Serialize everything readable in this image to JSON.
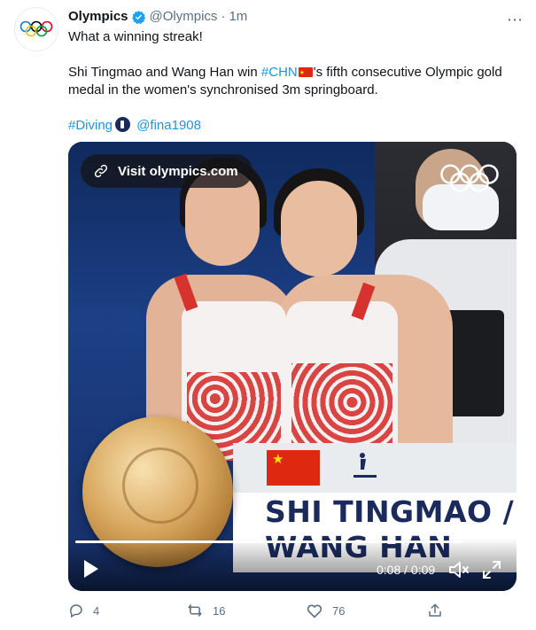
{
  "tweet": {
    "author_name": "Olympics",
    "handle": "@Olympics",
    "separator": "·",
    "time": "1m",
    "more_label": "⋯",
    "line1": "What a winning streak!",
    "line2_prefix": "Shi Tingmao and Wang Han win ",
    "hashtag_chn": "#CHN",
    "line2_suffix": "'s fifth consecutive Olympic gold medal in the women's synchronised 3m springboard.",
    "hashtag_diving": "#Diving",
    "mention": "@fina1908"
  },
  "media": {
    "visit_label": "Visit olympics.com",
    "banner_text_line1": "SHI TINGMAO /",
    "banner_text_line2": "WANG HAN",
    "time_readout": "0:08 / 0:09",
    "progress": 0.89
  },
  "actions": {
    "reply_count": "4",
    "retweet_count": "16",
    "like_count": "76"
  },
  "colors": {
    "link": "#1b95e0",
    "verified": "#1da1f2",
    "muted": "#5b7083"
  }
}
